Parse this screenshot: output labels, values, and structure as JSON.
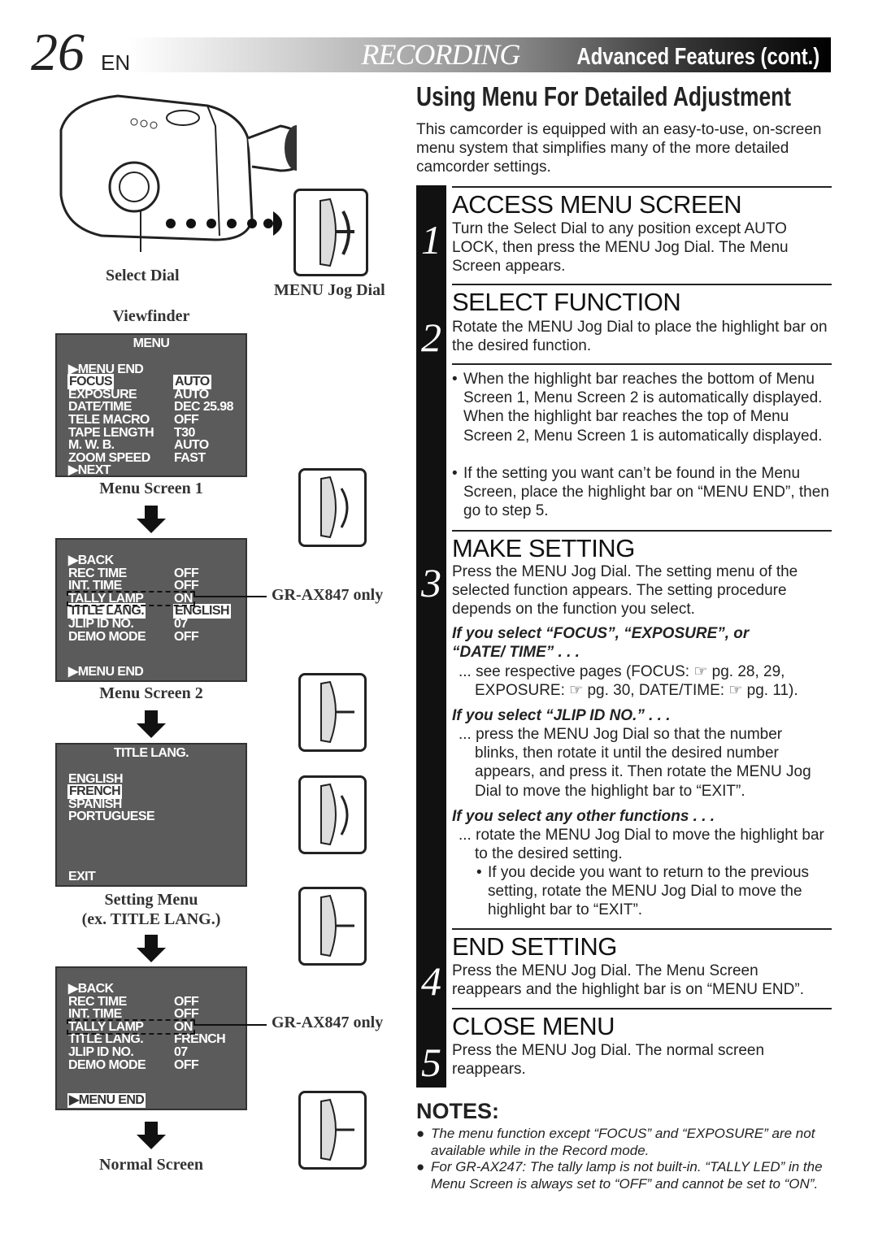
{
  "header": {
    "page_number": "26",
    "lang": "EN",
    "section_italic": "RECORDING",
    "section_rest": "Advanced Features (cont.)"
  },
  "title": "Using Menu For Detailed Adjustment",
  "intro": "This camcorder is equipped with an easy-to-use, on-screen menu system that simplifies many of the more detailed camcorder settings.",
  "illustration": {
    "select_dial": "Select Dial",
    "jog_dial": "MENU Jog Dial",
    "viewfinder": "Viewfinder",
    "model_note": "GR-AX847 only"
  },
  "menu1": {
    "title": "MENU",
    "caption": "Menu Screen 1",
    "rows": [
      {
        "l": "▶MENU  END",
        "v": ""
      },
      {
        "l": "FOCUS",
        "v": "AUTO",
        "hl": true
      },
      {
        "l": "EXPOSURE",
        "v": "AUTO"
      },
      {
        "l": "DATE⁄TIME",
        "v": "DEC 25.98"
      },
      {
        "l": "TELE  MACRO",
        "v": "OFF"
      },
      {
        "l": "TAPE  LENGTH",
        "v": "T30"
      },
      {
        "l": "M. W. B.",
        "v": "AUTO"
      },
      {
        "l": "ZOOM SPEED",
        "v": "FAST"
      },
      {
        "l": "▶NEXT",
        "v": ""
      }
    ]
  },
  "menu2": {
    "caption": "Menu Screen 2",
    "rows": [
      {
        "l": "▶BACK",
        "v": ""
      },
      {
        "l": "REC  TIME",
        "v": "OFF"
      },
      {
        "l": "INT.  TIME",
        "v": "OFF"
      },
      {
        "l": "TALLY  LAMP",
        "v": "ON",
        "dash": true
      },
      {
        "l": "TITLE  LANG.",
        "v": "ENGLISH",
        "hl": true
      },
      {
        "l": "JLIP  ID  NO.",
        "v": "07"
      },
      {
        "l": "DEMO  MODE",
        "v": "OFF"
      }
    ],
    "end": "▶MENU  END"
  },
  "menu3": {
    "title": "TITLE  LANG.",
    "caption1": "Setting Menu",
    "caption2": "(ex. TITLE LANG.)",
    "rows": [
      "ENGLISH",
      "FRENCH",
      "SPANISH",
      "PORTUGUESE"
    ],
    "highlight_index": 1,
    "exit": "EXIT"
  },
  "menu4": {
    "caption": "Normal Screen",
    "rows": [
      {
        "l": "▶BACK",
        "v": ""
      },
      {
        "l": "REC  TIME",
        "v": "OFF"
      },
      {
        "l": "INT.  TIME",
        "v": "OFF"
      },
      {
        "l": "TALLY  LAMP",
        "v": "ON",
        "dash": true
      },
      {
        "l": "TITLE  LANG.",
        "v": "FRENCH"
      },
      {
        "l": "JLIP  ID  NO.",
        "v": "07"
      },
      {
        "l": "DEMO  MODE",
        "v": "OFF"
      }
    ],
    "end": "▶MENU  END"
  },
  "steps": [
    {
      "num": "1",
      "heading": "ACCESS MENU SCREEN",
      "text": "Turn the Select Dial to any position except AUTO LOCK, then press the MENU Jog Dial. The Menu Screen appears."
    },
    {
      "num": "2",
      "heading": "SELECT FUNCTION",
      "text": "Rotate the MENU Jog Dial to place the highlight bar on the desired function.",
      "bullets": [
        "When the highlight bar reaches the bottom of Menu Screen 1, Menu Screen 2 is automatically displayed. When the highlight bar reaches the top of Menu Screen 2, Menu Screen 1 is automatically displayed.",
        "If the setting you want can’t be found in the Menu Screen, place the highlight bar on “MENU END”, then go to step 5."
      ]
    },
    {
      "num": "3",
      "heading": "MAKE SETTING",
      "text": "Press the MENU Jog Dial. The setting menu of the selected function appears. The setting procedure depends on the function you select.",
      "cases": [
        {
          "if": "If you select “FOCUS”, “EXPOSURE”, or “DATE/ TIME” . . .",
          "text": "... see respective pages (FOCUS: ☞ pg. 28, 29, EXPOSURE: ☞ pg. 30, DATE/TIME: ☞ pg. 11)."
        },
        {
          "if": "If you select “JLIP ID NO.” . . .",
          "text": "... press the MENU Jog Dial so that the number blinks, then rotate it until the desired number appears, and press it. Then rotate the MENU Jog Dial to move the highlight bar to “EXIT”."
        },
        {
          "if": "If you select any other functions . . .",
          "text": "... rotate the MENU Jog Dial to move the highlight bar to the desired setting.",
          "bullet": "If you decide you want to return to the previous setting, rotate the MENU Jog Dial to move the highlight bar to “EXIT”."
        }
      ]
    },
    {
      "num": "4",
      "heading": "END SETTING",
      "text": "Press the MENU Jog Dial. The Menu Screen reappears and the highlight bar is on “MENU END”."
    },
    {
      "num": "5",
      "heading": "CLOSE MENU",
      "text": "Press the MENU Jog Dial. The normal screen reappears."
    }
  ],
  "notes": {
    "heading": "NOTES:",
    "items": [
      "The menu function except “FOCUS” and “EXPOSURE” are not available while in the Record mode.",
      "For GR-AX247: The tally lamp is not built-in. “TALLY LED” in the Menu Screen is always set to “OFF” and cannot be set to “ON”."
    ]
  }
}
